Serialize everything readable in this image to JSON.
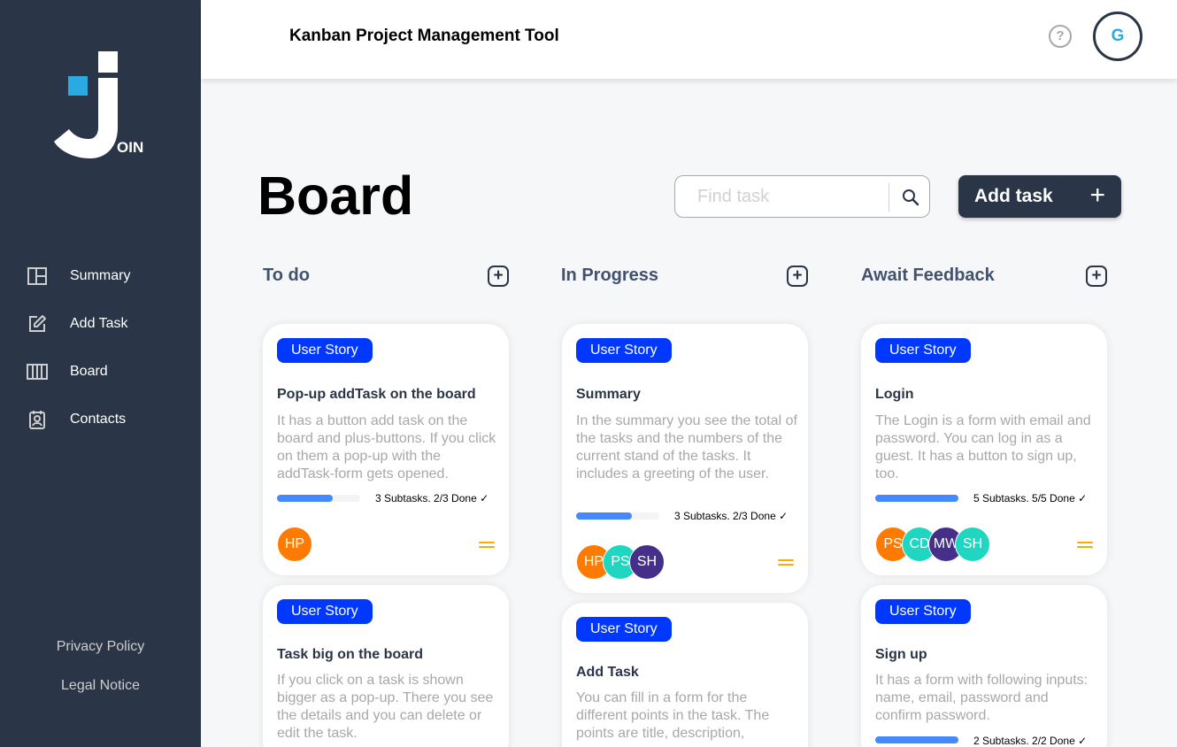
{
  "app": {
    "title": "Kanban Project Management Tool",
    "logo_suffix": "OIN",
    "help_label": "?",
    "user_initial": "G"
  },
  "sidebar": {
    "items": [
      {
        "label": "Summary",
        "icon": "summary-icon"
      },
      {
        "label": "Add Task",
        "icon": "edit-icon"
      },
      {
        "label": "Board",
        "icon": "board-icon"
      },
      {
        "label": "Contacts",
        "icon": "contacts-icon"
      }
    ],
    "footer": {
      "privacy": "Privacy Policy",
      "legal": "Legal Notice"
    }
  },
  "board": {
    "title": "Board",
    "search_placeholder": "Find task",
    "add_task_label": "Add task",
    "add_task_icon": "+",
    "add_symbol": "+"
  },
  "columns": [
    {
      "title": "To do"
    },
    {
      "title": "In Progress"
    },
    {
      "title": "Await Feedback"
    }
  ],
  "cards": [
    {
      "tag": "User Story",
      "title": "Pop-up addTask on the board",
      "description": "It has a button add task on the board and plus-buttons. If you click on them a pop-up with the addTask-form gets opened.",
      "progress": 0.67,
      "subtasks": "3 Subtasks. 2/3 Done ✓",
      "assignees": [
        {
          "initials": "HP",
          "color": "#ff7a00"
        }
      ],
      "priority": "medium"
    },
    {
      "tag": "User Story",
      "title": "Task big on the board",
      "description": "If you click on a task is shown bigger as a pop-up. There you see the details and you can delete or edit the task."
    },
    {
      "tag": "User Story",
      "title": "Summary",
      "description": "In the summary you see the total of the tasks and the numbers of the current stand of the tasks. It includes a greeting of the user.",
      "progress": 0.67,
      "subtasks": "3 Subtasks. 2/3 Done ✓",
      "assignees": [
        {
          "initials": "HP",
          "color": "#ff7a00"
        },
        {
          "initials": "PS",
          "color": "#1fd7c1"
        },
        {
          "initials": "SH",
          "color": "#462f8a"
        }
      ],
      "priority": "medium"
    },
    {
      "tag": "User Story",
      "title": "Add Task",
      "description": "You can fill in a form for the different points in the task. The points are title, description,"
    },
    {
      "tag": "User Story",
      "title": "Login",
      "description": "The Login is a form with email and password. You can log in as a guest. It has a button to sign up, too.",
      "progress": 1.0,
      "subtasks": "5 Subtasks. 5/5 Done ✓",
      "assignees": [
        {
          "initials": "PS",
          "color": "#ff7a00"
        },
        {
          "initials": "CD",
          "color": "#1fd7c1"
        },
        {
          "initials": "MW",
          "color": "#462f8a"
        },
        {
          "initials": "SH",
          "color": "#1fd7c1"
        }
      ],
      "priority": "medium"
    },
    {
      "tag": "User Story",
      "title": "Sign up",
      "description": "It has a form with following inputs: name, email, password and confirm password.",
      "progress": 1.0,
      "subtasks": "2 Subtasks. 2/2 Done ✓"
    }
  ],
  "colors": {
    "sidebar": "#2a3647",
    "accent": "#29abe2",
    "tag": "#0038ff",
    "progress": "#4589ff",
    "priority_medium": "#ffa800"
  }
}
